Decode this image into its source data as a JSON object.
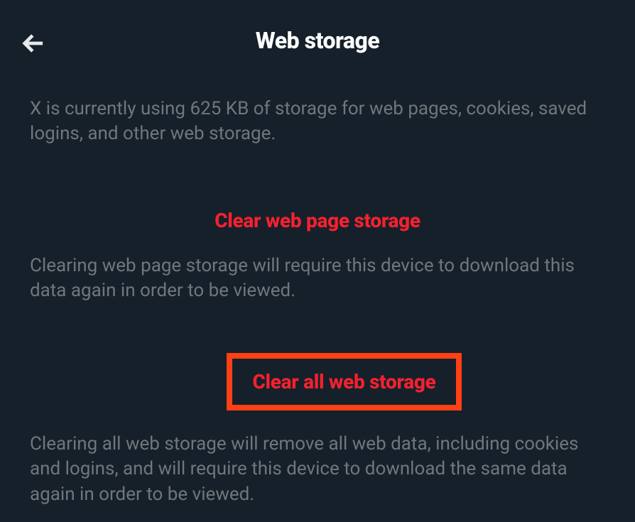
{
  "header": {
    "title": "Web storage"
  },
  "storage": {
    "info": "X is currently using 625 KB of storage for web pages, cookies, saved logins, and other web storage."
  },
  "actions": {
    "clearPage": {
      "label": "Clear web page storage",
      "description": "Clearing web page storage will require this device to download this data again in order to be viewed."
    },
    "clearAll": {
      "label": "Clear all web storage",
      "description": "Clearing all web storage will remove all web data, including cookies and logins, and will require this device to download the same data again in order to be viewed."
    }
  }
}
